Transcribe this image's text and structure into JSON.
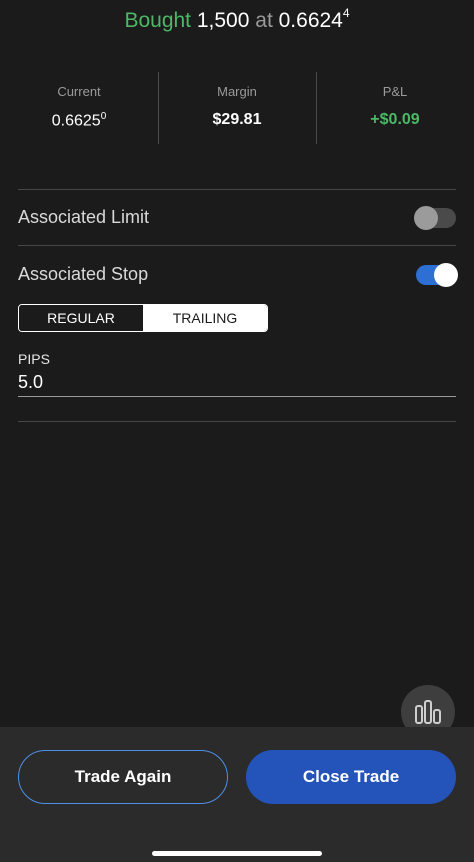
{
  "header": {
    "verb": "Bought",
    "quantity": "1,500",
    "at": "at",
    "price_main": "0.6624",
    "price_super": "4"
  },
  "stats": [
    {
      "label": "Current",
      "value_main": "0.6625",
      "value_super": "0"
    },
    {
      "label": "Margin",
      "value": "$29.81"
    },
    {
      "label": "P&L",
      "value": "+$0.09"
    }
  ],
  "associated_limit": {
    "label": "Associated Limit",
    "enabled": false
  },
  "associated_stop": {
    "label": "Associated Stop",
    "enabled": true
  },
  "stop_type": {
    "options": [
      "REGULAR",
      "TRAILING"
    ],
    "selected": "TRAILING"
  },
  "pips": {
    "label": "PIPS",
    "value": "5.0"
  },
  "actions": {
    "trade_again": "Trade Again",
    "close_trade": "Close Trade"
  },
  "icons": {
    "fab": "bar-chart-icon"
  },
  "colors": {
    "positive": "#4cb866",
    "accent": "#2d6fd3",
    "primary_button": "#2453ba"
  }
}
